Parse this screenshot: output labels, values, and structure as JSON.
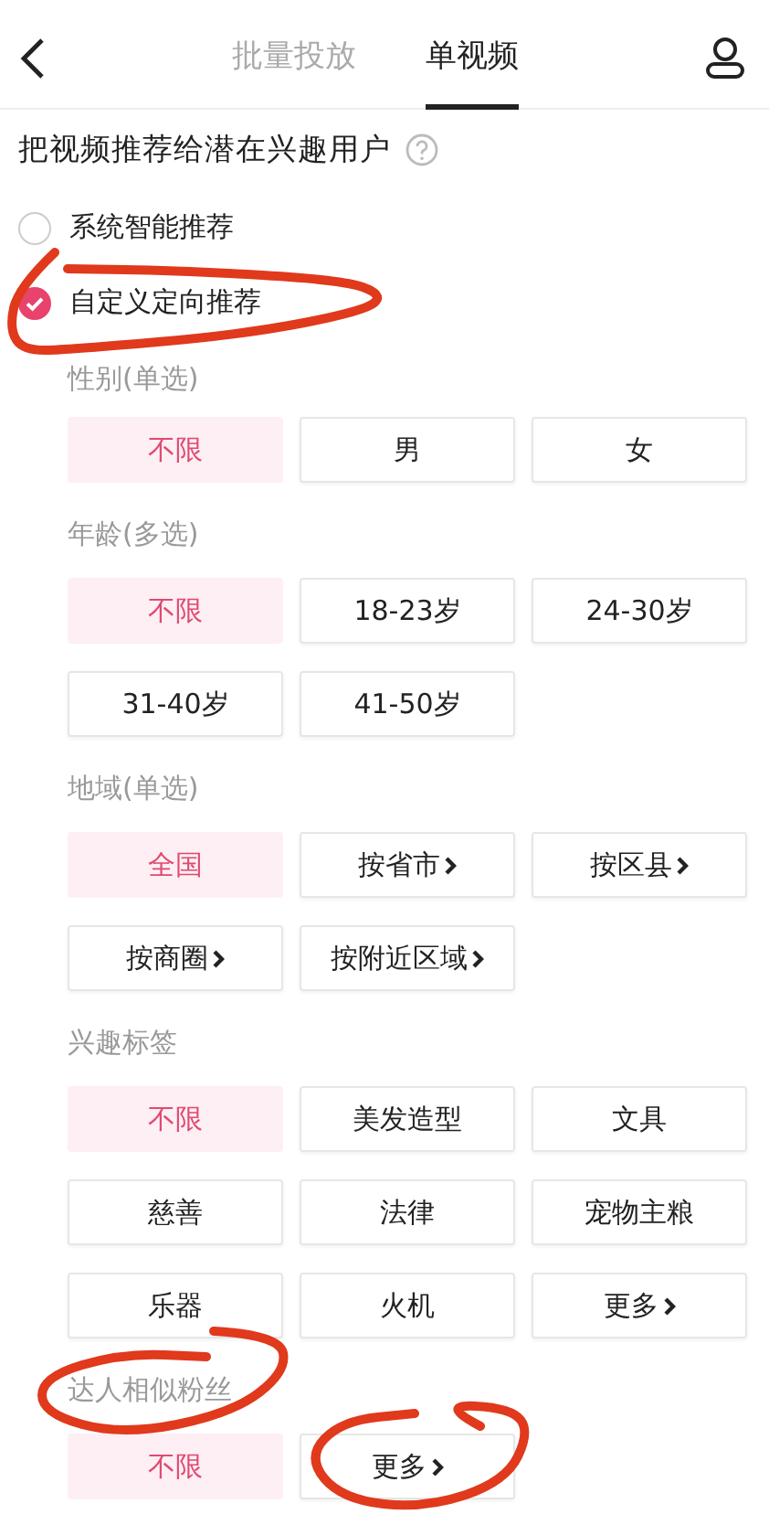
{
  "header": {
    "tabs": [
      {
        "label": "批量投放",
        "selected": false
      },
      {
        "label": "单视频",
        "selected": true
      }
    ]
  },
  "title": "把视频推荐给潜在兴趣用户",
  "modes": [
    {
      "label": "系统智能推荐",
      "selected": false
    },
    {
      "label": "自定义定向推荐",
      "selected": true
    }
  ],
  "sections": [
    {
      "label": "性别(单选)",
      "options": [
        {
          "label": "不限",
          "selected": true,
          "chevron": false
        },
        {
          "label": "男",
          "selected": false,
          "chevron": false
        },
        {
          "label": "女",
          "selected": false,
          "chevron": false
        }
      ]
    },
    {
      "label": "年龄(多选)",
      "options": [
        {
          "label": "不限",
          "selected": true,
          "chevron": false
        },
        {
          "label": "18-23岁",
          "selected": false,
          "chevron": false
        },
        {
          "label": "24-30岁",
          "selected": false,
          "chevron": false
        },
        {
          "label": "31-40岁",
          "selected": false,
          "chevron": false
        },
        {
          "label": "41-50岁",
          "selected": false,
          "chevron": false
        }
      ]
    },
    {
      "label": "地域(单选)",
      "options": [
        {
          "label": "全国",
          "selected": true,
          "chevron": false
        },
        {
          "label": "按省市",
          "selected": false,
          "chevron": true
        },
        {
          "label": "按区县",
          "selected": false,
          "chevron": true
        },
        {
          "label": "按商圈",
          "selected": false,
          "chevron": true
        },
        {
          "label": "按附近区域",
          "selected": false,
          "chevron": true
        }
      ]
    },
    {
      "label": "兴趣标签",
      "options": [
        {
          "label": "不限",
          "selected": true,
          "chevron": false
        },
        {
          "label": "美发造型",
          "selected": false,
          "chevron": false
        },
        {
          "label": "文具",
          "selected": false,
          "chevron": false
        },
        {
          "label": "慈善",
          "selected": false,
          "chevron": false
        },
        {
          "label": "法律",
          "selected": false,
          "chevron": false
        },
        {
          "label": "宠物主粮",
          "selected": false,
          "chevron": false
        },
        {
          "label": "乐器",
          "selected": false,
          "chevron": false
        },
        {
          "label": "火机",
          "selected": false,
          "chevron": false
        },
        {
          "label": "更多",
          "selected": false,
          "chevron": true
        }
      ]
    },
    {
      "label": "达人相似粉丝",
      "options": [
        {
          "label": "不限",
          "selected": true,
          "chevron": false
        },
        {
          "label": "更多",
          "selected": false,
          "chevron": true
        }
      ]
    }
  ]
}
